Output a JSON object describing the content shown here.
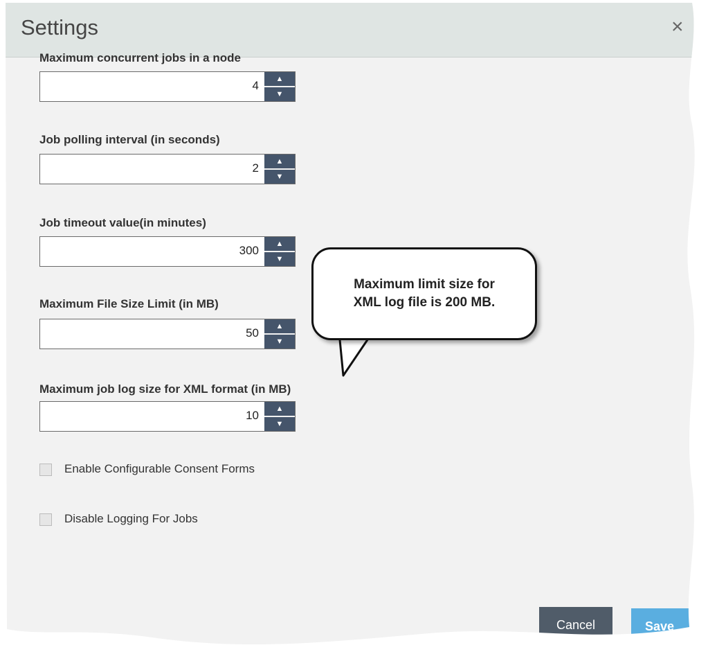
{
  "dialog": {
    "title": "Settings",
    "close_glyph": "×",
    "fields": [
      {
        "label": "Maximum concurrent jobs in a node",
        "value": "4"
      },
      {
        "label": "Job polling interval (in seconds)",
        "value": "2"
      },
      {
        "label": "Job timeout value(in minutes)",
        "value": "300"
      },
      {
        "label": "Maximum File Size Limit (in MB)",
        "value": "50"
      },
      {
        "label": "Maximum job log size for XML format (in MB)",
        "value": "10"
      }
    ],
    "checkboxes": [
      {
        "label": "Enable Configurable Consent Forms",
        "checked": false
      },
      {
        "label": "Disable Logging For Jobs",
        "checked": false
      }
    ],
    "buttons": {
      "cancel": "Cancel",
      "save": "Save"
    }
  },
  "callout": {
    "line1": "Maximum limit size for",
    "line2": "XML log file is 200 MB."
  },
  "icons": {
    "spin_up": "up-arrow-icon",
    "spin_down": "down-arrow-icon",
    "close": "close-icon"
  },
  "colors": {
    "spinner": "#45556b",
    "cancel": "#505c69",
    "save": "#5aaee0",
    "header": "#dfe5e3"
  }
}
